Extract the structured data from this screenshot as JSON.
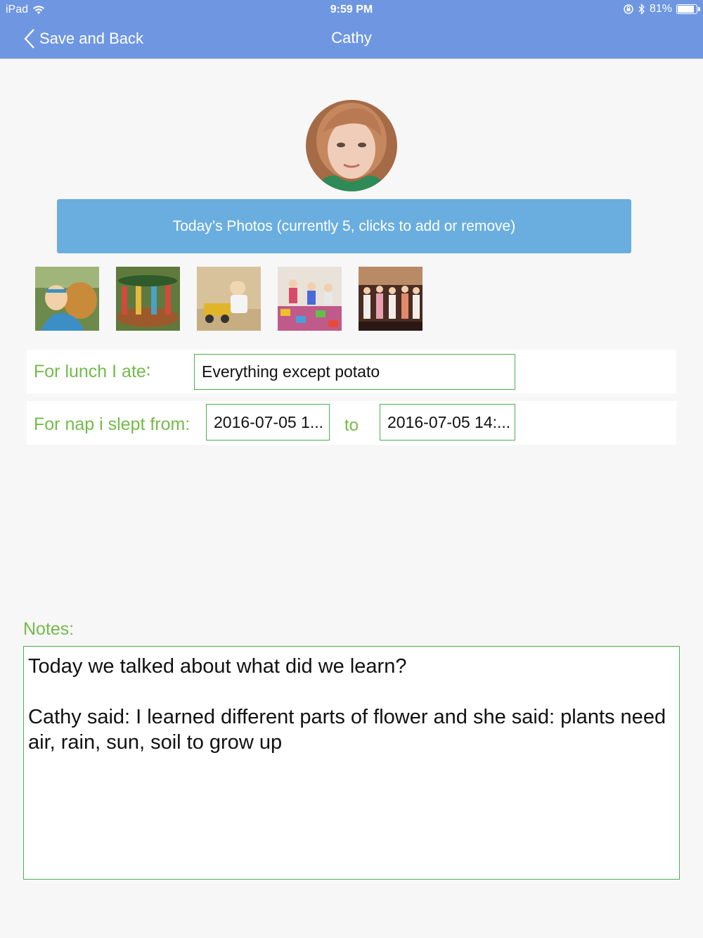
{
  "status_bar": {
    "device": "iPad",
    "time": "9:59 PM",
    "battery_percent": "81%",
    "battery_level": 0.81
  },
  "nav": {
    "back_label": "Save and Back",
    "title": "Cathy"
  },
  "profile": {
    "avatar_icon": "child-portrait"
  },
  "photos": {
    "button_label": "Today’s Photos (currently 5, clicks to add or remove)",
    "thumbnails": [
      "girl-with-dog",
      "carousel",
      "child-with-toy-truck",
      "playroom-children",
      "children-violin-performance"
    ]
  },
  "lunch": {
    "label": "For lunch I ate∶",
    "value": "Everything except potato"
  },
  "nap": {
    "label": "For nap i slept from:",
    "from_value": "2016-07-05 1...",
    "to_label": "to",
    "to_value": "2016-07-05 14:..."
  },
  "notes": {
    "label": "Notes:",
    "text": "Today we talked about what did we learn?\n\nCathy said: I learned different parts of flower and she said: plants need air, rain, sun, soil to grow up"
  },
  "colors": {
    "nav_bg": "#6f97e1",
    "button_bg": "#6aaedf",
    "label_green": "#73bb49",
    "border_green": "#4caf50"
  }
}
